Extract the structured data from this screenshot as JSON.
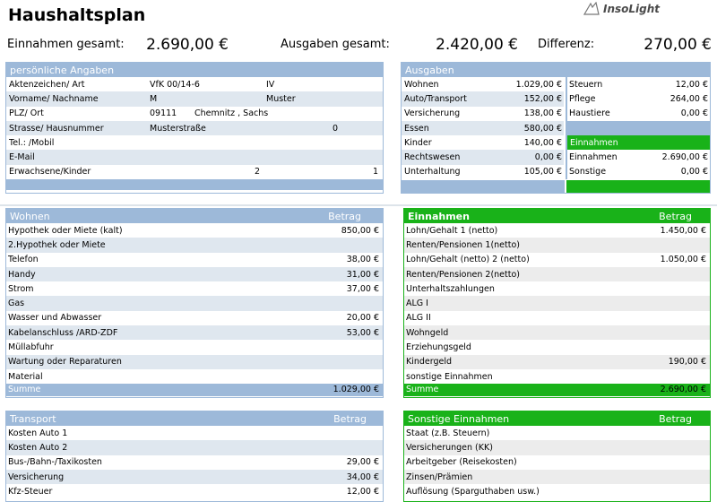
{
  "title": "Haushaltsplan",
  "logo": "InsoLight",
  "summary": {
    "einnahmen_label": "Einnahmen gesamt:",
    "einnahmen_value": "2.690,00 €",
    "ausgaben_label": "Ausgaben gesamt:",
    "ausgaben_value": "2.420,00 €",
    "differenz_label": "Differenz:",
    "differenz_value": "270,00 €"
  },
  "personal": {
    "header": "persönliche Angaben",
    "rows": [
      {
        "label": "Aktenzeichen/ Art",
        "v1": "VfK 00/14-6",
        "v2": "IV"
      },
      {
        "label": "Vorname/ Nachname",
        "v1": "M",
        "v2": "Muster"
      },
      {
        "label": "PLZ/ Ort",
        "v1": "09111",
        "v2": "Chemnitz , Sachs"
      },
      {
        "label": "Strasse/ Hausnummer",
        "v1": "Musterstraße",
        "v2": "0"
      },
      {
        "label": "Tel.: /Mobil",
        "v1": "",
        "v2": ""
      },
      {
        "label": "E-Mail",
        "v1": "",
        "v2": ""
      },
      {
        "label": "Erwachsene/Kinder",
        "v1": "2",
        "v2": "1"
      }
    ]
  },
  "ausgaben": {
    "header": "Ausgaben",
    "left": [
      {
        "label": "Wohnen",
        "value": "1.029,00 €"
      },
      {
        "label": "Auto/Transport",
        "value": "152,00 €"
      },
      {
        "label": "Versicherung",
        "value": "138,00 €"
      },
      {
        "label": "Essen",
        "value": "580,00 €"
      },
      {
        "label": "Kinder",
        "value": "140,00 €"
      },
      {
        "label": "Rechtswesen",
        "value": "0,00 €"
      },
      {
        "label": "Unterhaltung",
        "value": "105,00 €"
      }
    ],
    "right": [
      {
        "label": "Steuern",
        "value": "12,00 €"
      },
      {
        "label": "Pflege",
        "value": "264,00 €"
      },
      {
        "label": "Haustiere",
        "value": "0,00 €"
      }
    ],
    "einnahmen_header": "Einnahmen",
    "right_einnahmen": [
      {
        "label": "Einnahmen",
        "value": "2.690,00 €"
      },
      {
        "label": "Sonstige",
        "value": "0,00 €"
      }
    ]
  },
  "wohnen": {
    "header": "Wohnen",
    "betrag": "Betrag",
    "rows": [
      {
        "label": "Hypothek oder Miete (kalt)",
        "value": "850,00 €"
      },
      {
        "label": "2.Hypothek oder Miete",
        "value": ""
      },
      {
        "label": "Telefon",
        "value": "38,00 €"
      },
      {
        "label": "Handy",
        "value": "31,00 €"
      },
      {
        "label": "Strom",
        "value": "37,00 €"
      },
      {
        "label": "Gas",
        "value": ""
      },
      {
        "label": "Wasser und Abwasser",
        "value": "20,00 €"
      },
      {
        "label": "Kabelanschluss /ARD-ZDF",
        "value": "53,00 €"
      },
      {
        "label": "Müllabfuhr",
        "value": ""
      },
      {
        "label": "Wartung oder Reparaturen",
        "value": ""
      },
      {
        "label": "Material",
        "value": ""
      }
    ],
    "sum_label": "Summe",
    "sum_value": "1.029,00 €"
  },
  "einnahmen": {
    "header": "Einnahmen",
    "betrag": "Betrag",
    "rows": [
      {
        "label": "Lohn/Gehalt 1 (netto)",
        "value": "1.450,00 €"
      },
      {
        "label": "Renten/Pensionen 1(netto)",
        "value": ""
      },
      {
        "label": "Lohn/Gehalt (netto) 2 (netto)",
        "value": "1.050,00 €"
      },
      {
        "label": "Renten/Pensionen 2(netto)",
        "value": ""
      },
      {
        "label": "Unterhaltszahlungen",
        "value": ""
      },
      {
        "label": "ALG I",
        "value": ""
      },
      {
        "label": "ALG II",
        "value": ""
      },
      {
        "label": "Wohngeld",
        "value": ""
      },
      {
        "label": "Erziehungsgeld",
        "value": ""
      },
      {
        "label": "Kindergeld",
        "value": "190,00 €"
      },
      {
        "label": "sonstige Einnahmen",
        "value": ""
      }
    ],
    "sum_label": "Summe",
    "sum_value": "2.690,00 €"
  },
  "transport": {
    "header": "Transport",
    "betrag": "Betrag",
    "rows": [
      {
        "label": "Kosten Auto 1",
        "value": ""
      },
      {
        "label": "Kosten Auto 2",
        "value": ""
      },
      {
        "label": "Bus-/Bahn-/Taxikosten",
        "value": "29,00 €"
      },
      {
        "label": "Versicherung",
        "value": "34,00 €"
      },
      {
        "label": "Kfz-Steuer",
        "value": "12,00 €"
      }
    ]
  },
  "sonstige": {
    "header": "Sonstige Einnahmen",
    "betrag": "Betrag",
    "rows": [
      {
        "label": "Staat (z.B. Steuern)",
        "value": ""
      },
      {
        "label": "Versicherungen (KK)",
        "value": ""
      },
      {
        "label": "Arbeitgeber (Reisekosten)",
        "value": ""
      },
      {
        "label": "Zinsen/Prämien",
        "value": ""
      },
      {
        "label": "Auflösung (Sparguthaben usw.)",
        "value": ""
      }
    ]
  }
}
